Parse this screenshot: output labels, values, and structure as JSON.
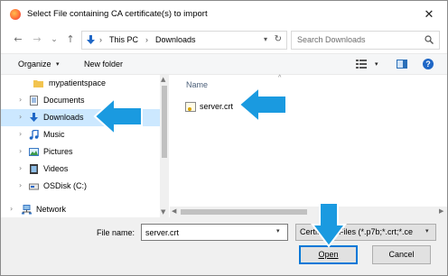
{
  "window": {
    "title": "Select File containing CA certificate(s) to import",
    "close_glyph": "✕"
  },
  "nav": {
    "back_glyph": "←",
    "forward_glyph": "→",
    "recent_glyph": "⌄",
    "up_glyph": "↑",
    "path": [
      "This PC",
      "Downloads"
    ],
    "path_separator": "›",
    "refresh_glyph": "↻",
    "search_placeholder": "Search Downloads"
  },
  "toolbar": {
    "organize_label": "Organize",
    "new_folder_label": "New folder",
    "caret": "▾",
    "help_glyph": "?"
  },
  "sidebar": {
    "items": [
      {
        "label": "mypatientspace",
        "icon": "folder-icon",
        "indent": 2
      },
      {
        "label": "Documents",
        "icon": "documents-icon",
        "indent": 1
      },
      {
        "label": "Downloads",
        "icon": "downloads-icon",
        "indent": 1,
        "selected": true
      },
      {
        "label": "Music",
        "icon": "music-icon",
        "indent": 1
      },
      {
        "label": "Pictures",
        "icon": "pictures-icon",
        "indent": 1
      },
      {
        "label": "Videos",
        "icon": "videos-icon",
        "indent": 1
      },
      {
        "label": "OSDisk (C:)",
        "icon": "drive-icon",
        "indent": 1
      },
      {
        "label": "Network",
        "icon": "network-icon",
        "indent": 0
      }
    ]
  },
  "content": {
    "column_name": "Name",
    "files": [
      {
        "name": "server.crt",
        "icon": "certificate-file-icon"
      }
    ]
  },
  "footer": {
    "file_name_label": "File name:",
    "file_name_value": "server.crt",
    "filter_value": "Certificate Files (*.p7b;*.crt;*.ce",
    "open_label": "Open",
    "cancel_label": "Cancel"
  },
  "colors": {
    "accent": "#0078d7",
    "overlay_arrow": "#1a9ae0",
    "selection": "#cce8ff"
  }
}
